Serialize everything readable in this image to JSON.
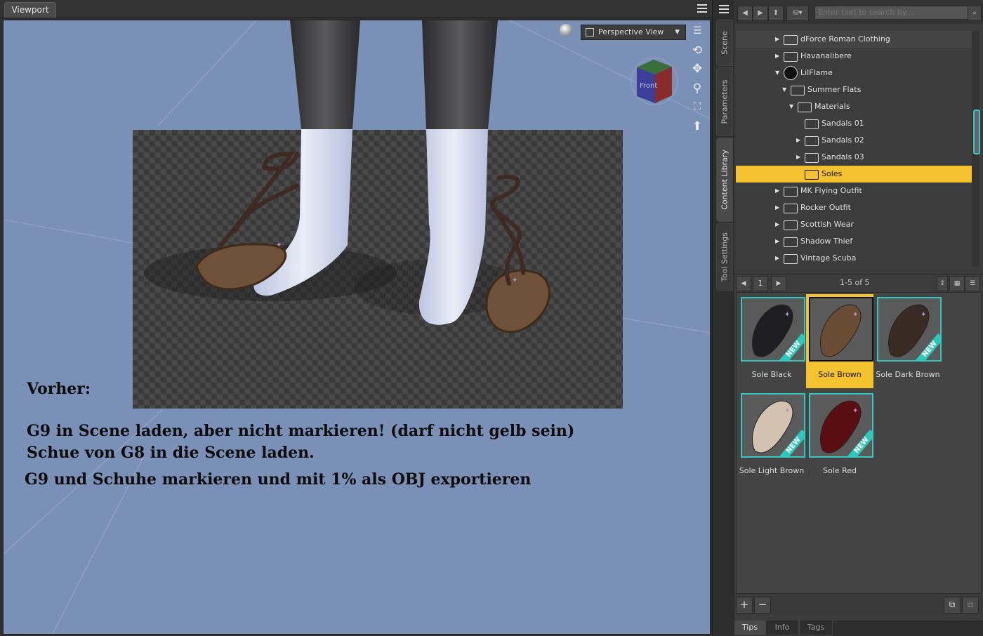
{
  "viewport": {
    "tab_label": "Viewport",
    "view_dropdown": "Perspective View",
    "cube_face": "Front",
    "notes": {
      "heading": "Vorher:",
      "line1": "G9 in Scene laden, aber nicht markieren! (darf nicht gelb sein)",
      "line2": "Schue von G8 in die Scene laden.",
      "line3": "G9 und Schuhe markieren und mit 1% als OBJ exportieren"
    }
  },
  "side_tabs": [
    "Scene",
    "Parameters",
    "Content Library",
    "Tool Settings"
  ],
  "library": {
    "search_placeholder": "Enter text to search by...",
    "tree": [
      {
        "label": "dForce Roman Clothing",
        "state": "collapsed",
        "level": 0,
        "highlight": true
      },
      {
        "label": "Havanalibere",
        "state": "collapsed",
        "level": 0
      },
      {
        "label": "LilFlame",
        "state": "expanded",
        "level": 0,
        "icon": "vendor-logo-icon"
      },
      {
        "label": "Summer Flats",
        "state": "expanded",
        "level": 1
      },
      {
        "label": "Materials",
        "state": "expanded",
        "level": 2
      },
      {
        "label": "Sandals 01",
        "state": "leaf",
        "level": 3
      },
      {
        "label": "Sandals 02",
        "state": "collapsed",
        "level": 3
      },
      {
        "label": "Sandals 03",
        "state": "collapsed",
        "level": 3
      },
      {
        "label": "Soles",
        "state": "leaf",
        "level": 3,
        "selected": true
      },
      {
        "label": "MK Flying Outfit",
        "state": "collapsed",
        "level": 0
      },
      {
        "label": "Rocker Outfit",
        "state": "collapsed",
        "level": 0
      },
      {
        "label": "Scottish Wear",
        "state": "collapsed",
        "level": 0
      },
      {
        "label": "Shadow Thief",
        "state": "collapsed",
        "level": 0
      },
      {
        "label": "Vintage Scuba",
        "state": "collapsed",
        "level": 0
      }
    ],
    "pager": {
      "page": "1",
      "count": "1-5 of 5"
    },
    "items": [
      {
        "label": "Sole Black",
        "color": "#1e1e22",
        "new": true,
        "selected": false
      },
      {
        "label": "Sole Brown",
        "color": "#6a4c35",
        "new": false,
        "selected": true
      },
      {
        "label": "Sole Dark Brown",
        "color": "#3a2a24",
        "new": true,
        "selected": false
      },
      {
        "label": "Sole Light Brown",
        "color": "#d2c3b0",
        "new": true,
        "selected": false
      },
      {
        "label": "Sole Red",
        "color": "#5a0e12",
        "new": true,
        "selected": false
      }
    ],
    "new_badge": "NEW",
    "bottom_tabs": [
      "Tips",
      "Info",
      "Tags"
    ]
  }
}
